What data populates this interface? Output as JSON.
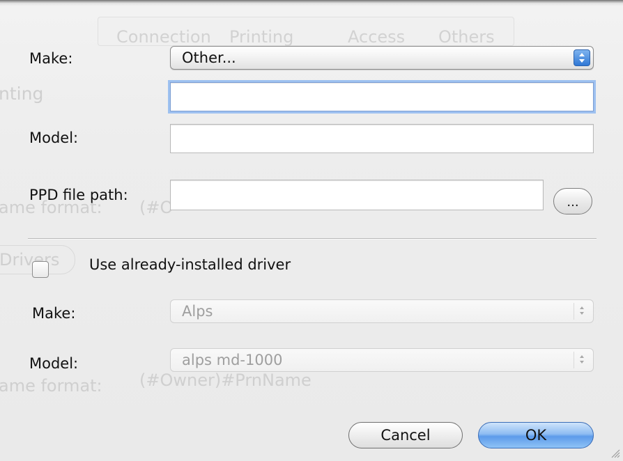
{
  "background": {
    "tabs": [
      "Connection",
      "Printing",
      "Access",
      "Others"
    ],
    "section_fragment": "nting",
    "name_format_label": "ame format:",
    "name_format_value_partial": "(#O",
    "drivers_button": "Drivers",
    "name_format_label_2": "ame format:",
    "name_format_value_2": "(#Owner)#PrnName"
  },
  "dialog": {
    "make_label": "Make:",
    "make_value": "Other...",
    "custom_make_value": "",
    "model_label": "Model:",
    "model_value": "",
    "ppd_label": "PPD file path:",
    "ppd_value": "",
    "browse_label": "...",
    "use_installed_label": "Use already-installed driver",
    "use_installed_checked": false,
    "installed_make_label": "Make:",
    "installed_make_value": "Alps",
    "installed_model_label": "Model:",
    "installed_model_value": "alps md-1000",
    "cancel_label": "Cancel",
    "ok_label": "OK"
  },
  "colors": {
    "accent": "#5d9bea",
    "focus_ring": "#9ec1f0"
  }
}
